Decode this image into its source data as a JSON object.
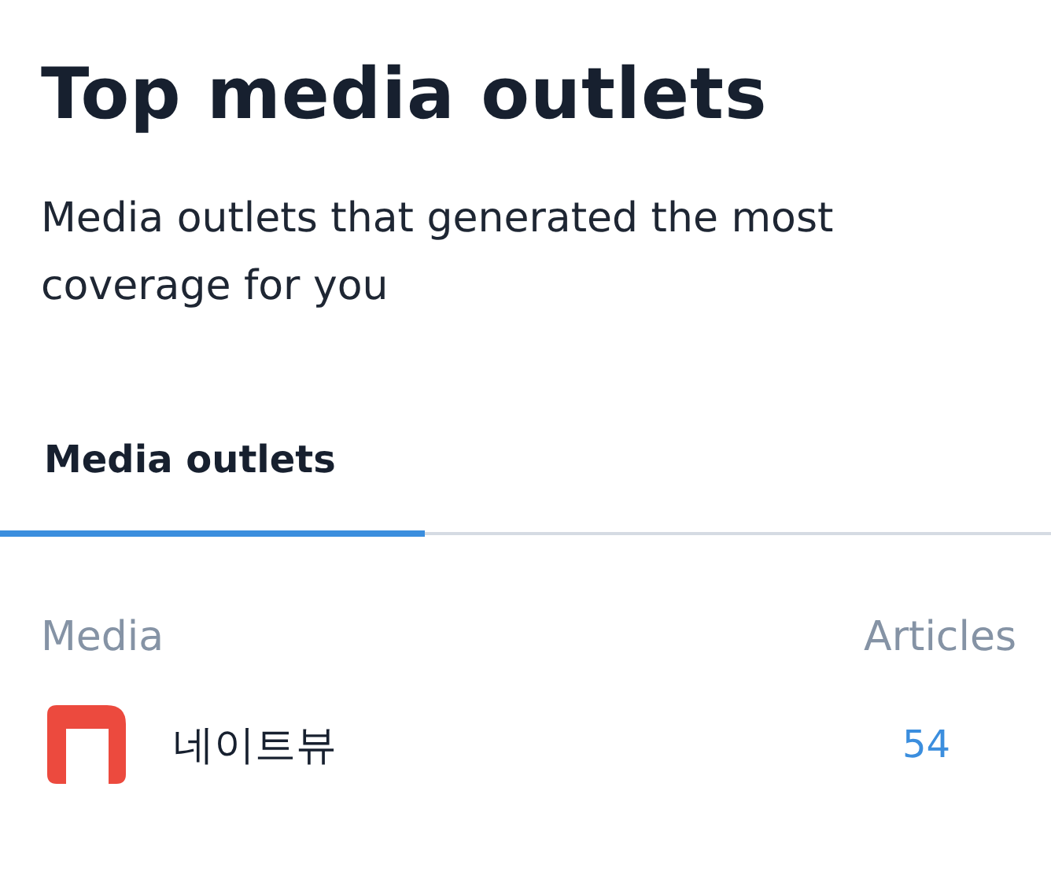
{
  "title": "Top media outlets",
  "description": "Media outlets that generated the most coverage for you",
  "tabs": [
    {
      "label": "Media outlets",
      "selected": true
    }
  ],
  "table": {
    "columns": [
      "Media",
      "Articles"
    ],
    "rows": [
      {
        "media": "네이트뷰",
        "articles": "54"
      }
    ]
  }
}
